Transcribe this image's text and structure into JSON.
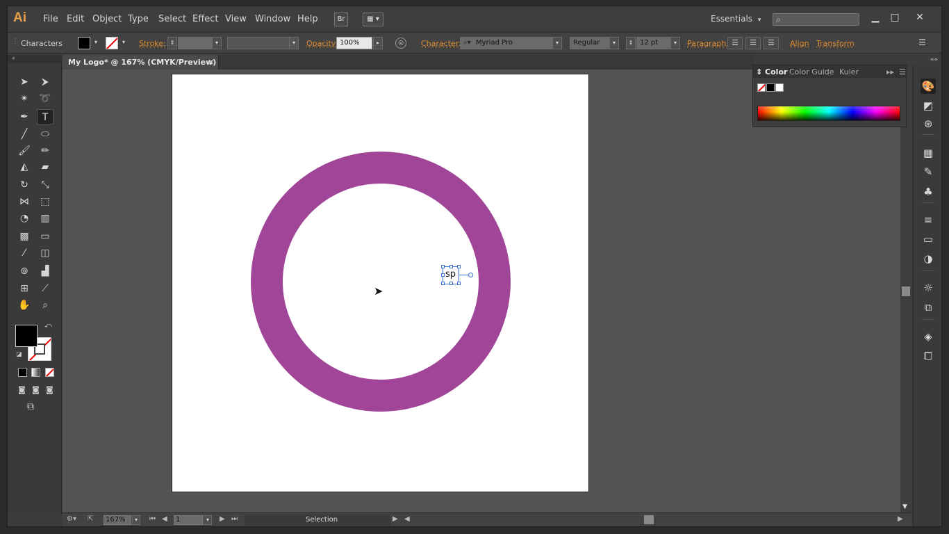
{
  "app": {
    "logo": "Ai"
  },
  "menu": [
    "File",
    "Edit",
    "Object",
    "Type",
    "Select",
    "Effect",
    "View",
    "Window",
    "Help"
  ],
  "bridge_button": "Br",
  "workspace": "Essentials",
  "controlbar": {
    "selection_label": "Characters",
    "stroke_label": "Stroke:",
    "opacity_label": "Opacity:",
    "opacity_value": "100%",
    "character_label": "Character:",
    "font_family": "Myriad Pro",
    "font_style": "Regular",
    "font_size": "12 pt",
    "paragraph_label": "Paragraph:",
    "align_label": "Align",
    "transform_label": "Transform",
    "fill_color": "#000000"
  },
  "document": {
    "tab_title": "My Logo* @ 167% (CMYK/Preview)",
    "close": "×"
  },
  "artwork": {
    "ring_color": "#a04598",
    "text_object": "sp"
  },
  "statusbar": {
    "zoom": "167%",
    "artboard": "1",
    "tool_status": "Selection"
  },
  "color_panel": {
    "tabs": [
      "Color",
      "Color Guide",
      "Kuler"
    ]
  },
  "accent": "#e08c2e"
}
